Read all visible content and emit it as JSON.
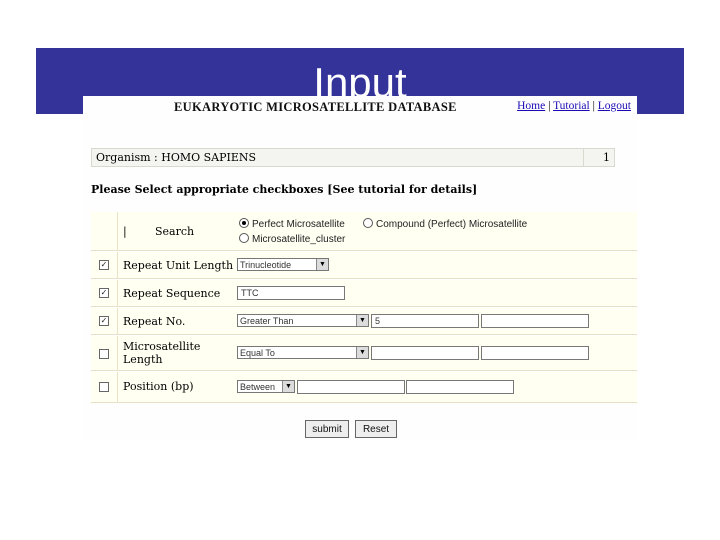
{
  "slide": {
    "title": "Input"
  },
  "app": {
    "title": "EUKARYOTIC MICROSATELLITE DATABASE",
    "links": {
      "home": "Home",
      "tutorial": "Tutorial",
      "logout": "Logout",
      "separator": "|"
    }
  },
  "organism": {
    "label": "Organism : HOMO SAPIENS",
    "count": "1"
  },
  "instructions": "Please Select appropriate checkboxes [See tutorial for details]",
  "form": {
    "search": {
      "bar": "|",
      "label": "Search",
      "options": [
        "Perfect Microsatellite",
        "Compound (Perfect) Microsatellite",
        "Microsatellite_cluster"
      ],
      "selected": 0
    },
    "repeat_unit_length": {
      "label": "Repeat Unit Length",
      "checked": true,
      "select": "Trinucleotide"
    },
    "repeat_sequence": {
      "label": "Repeat Sequence",
      "checked": true,
      "value": "TTC"
    },
    "repeat_no": {
      "label": "Repeat No.",
      "checked": true,
      "select": "Greater Than",
      "value1": "5",
      "value2": ""
    },
    "microsatellite_length": {
      "label1": "Microsatellite",
      "label2": "Length",
      "checked": false,
      "select": "Equal To",
      "value1": "",
      "value2": ""
    },
    "position": {
      "label": "Position (bp)",
      "checked": false,
      "select": "Between",
      "value1": "",
      "value2": ""
    }
  },
  "buttons": {
    "submit": "submit",
    "reset": "Reset"
  },
  "icons": {
    "checkmark": "✓",
    "dropdown_arrow": "▼"
  },
  "colors": {
    "title_bar": "#333399",
    "link": "#1a0ab5",
    "row_bg": "#fffff2"
  }
}
